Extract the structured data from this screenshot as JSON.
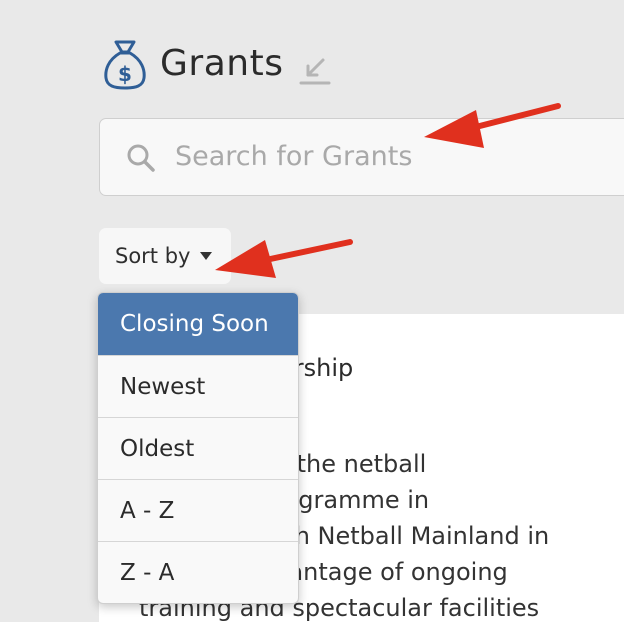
{
  "header": {
    "title": "Grants",
    "icon": "money-bag-icon",
    "collapse_icon": "arrow-down-left-icon"
  },
  "search": {
    "placeholder": "Search for Grants",
    "icon": "search-icon"
  },
  "sort": {
    "label": "Sort by",
    "caret_icon": "caret-down-icon",
    "options": [
      "Closing Soon",
      "Newest",
      "Oldest",
      "A - Z",
      "Z - A"
    ],
    "selected": "Closing Soon"
  },
  "card": {
    "title_fragment": "etball Scholarship",
    "body_lines": [
      "ed the netball",
      "programme in",
      "with Netball Mainland in",
      "dvantage of ongoing",
      "training and spectacular facilities"
    ]
  },
  "colors": {
    "background": "#e9e9e9",
    "selected_option": "#4b78ae",
    "annotation_arrow": "#e0301e",
    "icon_blue": "#2f5e96"
  }
}
